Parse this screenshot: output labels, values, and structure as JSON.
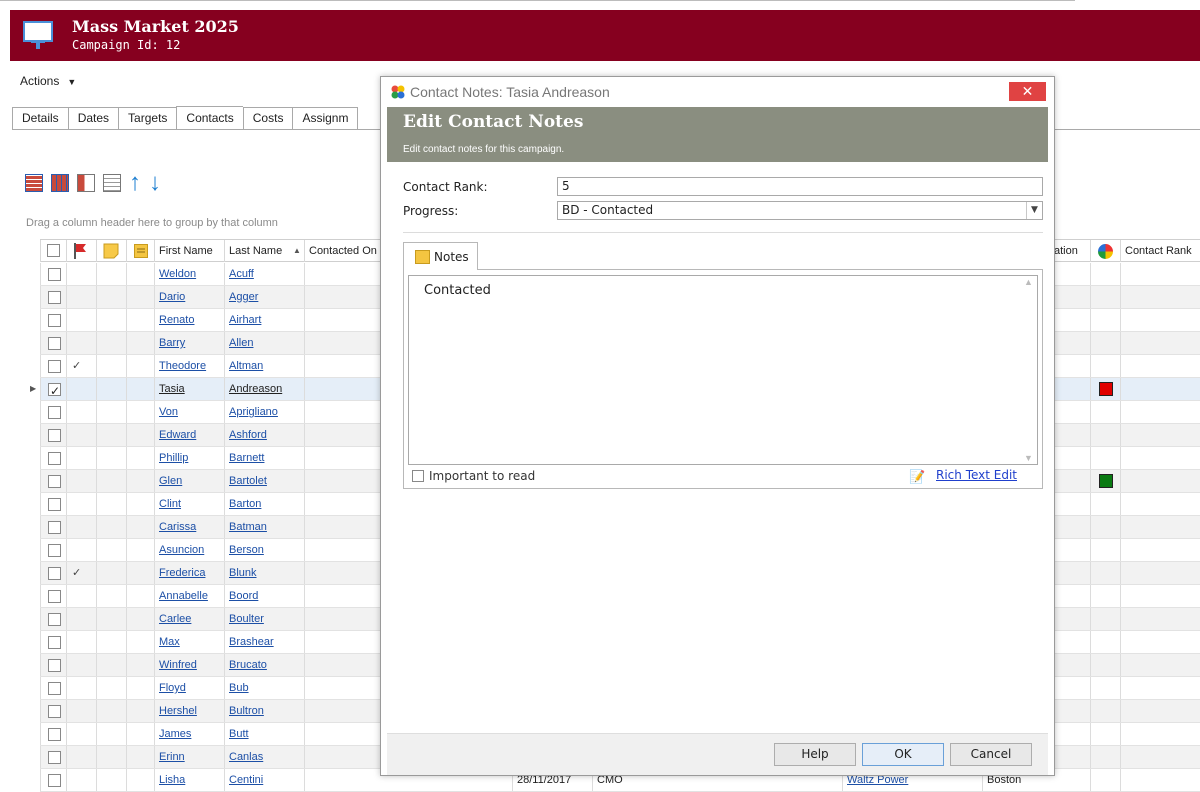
{
  "header": {
    "title": "Mass Market 2025",
    "subtitle": "Campaign Id: 12"
  },
  "actions": {
    "label": "Actions"
  },
  "tabs": [
    "Details",
    "Dates",
    "Targets",
    "Contacts",
    "Costs",
    "Assignm"
  ],
  "active_tab": "Contacts",
  "grid": {
    "group_hint": "Drag a column header here to group by that column",
    "columns": {
      "first_name": "First Name",
      "last_name": "Last Name",
      "contacted_on": "Contacted On",
      "location": "ation",
      "contact_rank": "Contact Rank"
    },
    "rows": [
      {
        "first": "Weldon",
        "last": "Acuff",
        "tick": "",
        "checked": false,
        "color": ""
      },
      {
        "first": "Dario",
        "last": "Agger",
        "tick": "",
        "checked": false,
        "color": ""
      },
      {
        "first": "Renato",
        "last": "Airhart",
        "tick": "",
        "checked": false,
        "color": ""
      },
      {
        "first": "Barry",
        "last": "Allen",
        "tick": "",
        "checked": false,
        "color": ""
      },
      {
        "first": "Theodore",
        "last": "Altman",
        "tick": "✓",
        "checked": false,
        "color": ""
      },
      {
        "first": "Tasia",
        "last": "Andreason",
        "tick": "",
        "checked": true,
        "color": "#e00000"
      },
      {
        "first": "Von",
        "last": "Aprigliano",
        "tick": "",
        "checked": false,
        "color": ""
      },
      {
        "first": "Edward",
        "last": "Ashford",
        "tick": "",
        "checked": false,
        "color": ""
      },
      {
        "first": "Phillip",
        "last": "Barnett",
        "tick": "",
        "checked": false,
        "color": ""
      },
      {
        "first": "Glen",
        "last": "Bartolet",
        "tick": "",
        "checked": false,
        "color": "#0a7a12"
      },
      {
        "first": "Clint",
        "last": "Barton",
        "tick": "",
        "checked": false,
        "color": ""
      },
      {
        "first": "Carissa",
        "last": "Batman",
        "tick": "",
        "checked": false,
        "color": ""
      },
      {
        "first": "Asuncion",
        "last": "Berson",
        "tick": "",
        "checked": false,
        "color": ""
      },
      {
        "first": "Frederica",
        "last": "Blunk",
        "tick": "✓",
        "checked": false,
        "color": ""
      },
      {
        "first": "Annabelle",
        "last": "Boord",
        "tick": "",
        "checked": false,
        "color": ""
      },
      {
        "first": "Carlee",
        "last": "Boulter",
        "tick": "",
        "checked": false,
        "color": ""
      },
      {
        "first": "Max",
        "last": "Brashear",
        "tick": "",
        "checked": false,
        "color": ""
      },
      {
        "first": "Winfred",
        "last": "Brucato",
        "tick": "",
        "checked": false,
        "color": ""
      },
      {
        "first": "Floyd",
        "last": "Bub",
        "tick": "",
        "checked": false,
        "color": ""
      },
      {
        "first": "Hershel",
        "last": "Bultron",
        "tick": "",
        "checked": false,
        "color": ""
      },
      {
        "first": "James",
        "last": "Butt",
        "tick": "",
        "checked": false,
        "color": ""
      },
      {
        "first": "Erinn",
        "last": "Canlas",
        "tick": "",
        "checked": false,
        "color": ""
      },
      {
        "first": "Lisha",
        "last": "Centini",
        "tick": "",
        "checked": false,
        "color": "",
        "date": "28/11/2017",
        "title": "CMO",
        "company": "Waltz Power",
        "city": "Boston"
      }
    ]
  },
  "dialog": {
    "window_title": "Contact Notes: Tasia Andreason",
    "close_label": "✕",
    "banner_title": "Edit Contact Notes",
    "banner_subtitle": "Edit contact notes for this campaign.",
    "rank_label": "Contact Rank:",
    "rank_value": "5",
    "progress_label": "Progress:",
    "progress_value": "BD - Contacted",
    "notes_tab": "Notes",
    "notes_text": "Contacted",
    "important_label": "Important to read",
    "rich_text_label": "Rich Text Edit",
    "buttons": {
      "help": "Help",
      "ok": "OK",
      "cancel": "Cancel"
    }
  },
  "colors": {
    "header_bg": "#86001f",
    "banner_bg": "#8a8e80",
    "link": "#1c4fa6",
    "close_bg": "#e04343"
  }
}
